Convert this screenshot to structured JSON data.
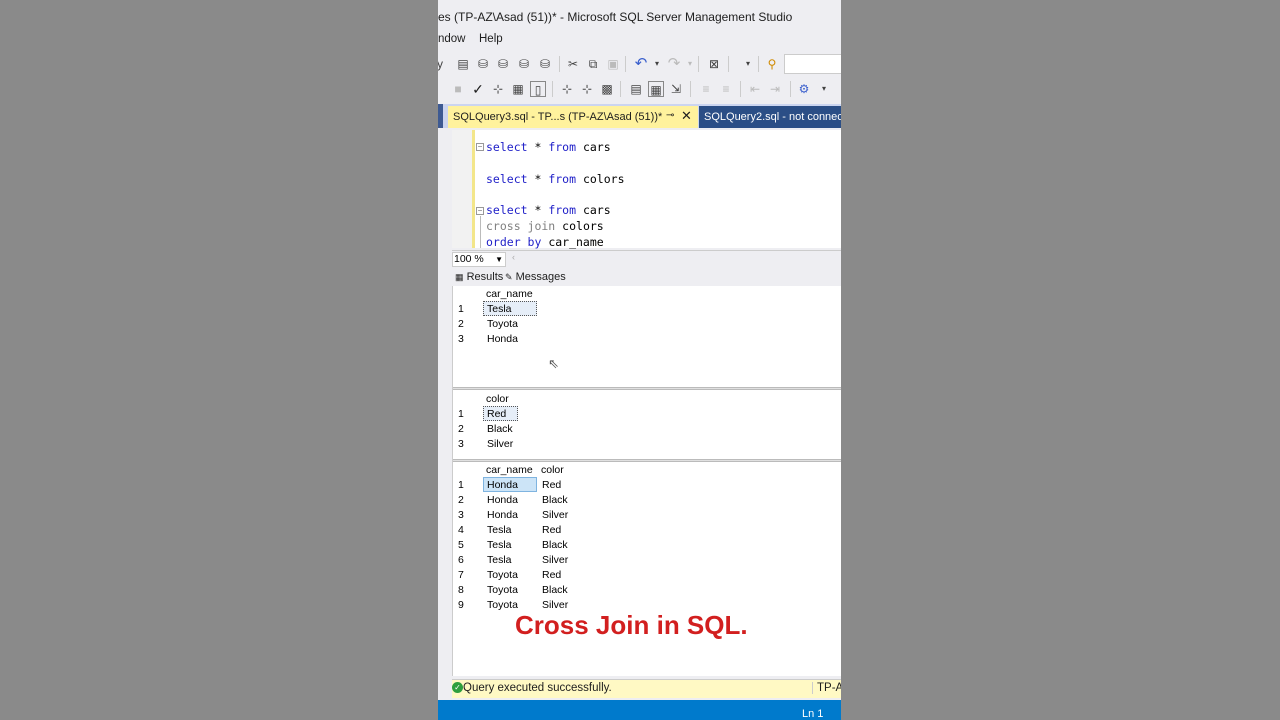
{
  "window": {
    "title": "es (TP-AZ\\Asad (51))* - Microsoft SQL Server Management Studio"
  },
  "menu": {
    "items": [
      "ndow",
      "Help"
    ]
  },
  "tabs": {
    "active": {
      "label": "SQLQuery3.sql - TP...s (TP-AZ\\Asad (51))*"
    },
    "other": {
      "label": "SQLQuery2.sql - not connected"
    }
  },
  "editor": {
    "lines": [
      {
        "kw1": "select",
        "rest1": " * ",
        "kw2": "from",
        "rest2": " cars"
      },
      {
        "kw1": "select",
        "rest1": " * ",
        "kw2": "from",
        "rest2": " colors"
      },
      {
        "kw1": "select",
        "rest1": " * ",
        "kw2": "from",
        "rest2": " cars"
      },
      {
        "kw1": "cross join",
        "rest1": " colors",
        "kw2": "",
        "rest2": ""
      },
      {
        "kw1": "order by",
        "rest1": " car_name",
        "kw2": "",
        "rest2": ""
      }
    ]
  },
  "zoom": {
    "value": "100 %"
  },
  "result_tabs": {
    "results": "Results",
    "messages": "Messages"
  },
  "grids": {
    "cars": {
      "header": "car_name",
      "rows": [
        {
          "num": "1",
          "car_name": "Tesla"
        },
        {
          "num": "2",
          "car_name": "Toyota"
        },
        {
          "num": "3",
          "car_name": "Honda"
        }
      ]
    },
    "colors": {
      "header": "color",
      "rows": [
        {
          "num": "1",
          "color": "Red"
        },
        {
          "num": "2",
          "color": "Black"
        },
        {
          "num": "3",
          "color": "Silver"
        }
      ]
    },
    "cross": {
      "headers": [
        "car_name",
        "color"
      ],
      "rows": [
        {
          "num": "1",
          "car_name": "Honda",
          "color": "Red"
        },
        {
          "num": "2",
          "car_name": "Honda",
          "color": "Black"
        },
        {
          "num": "3",
          "car_name": "Honda",
          "color": "Silver"
        },
        {
          "num": "4",
          "car_name": "Tesla",
          "color": "Red"
        },
        {
          "num": "5",
          "car_name": "Tesla",
          "color": "Black"
        },
        {
          "num": "6",
          "car_name": "Tesla",
          "color": "Silver"
        },
        {
          "num": "7",
          "car_name": "Toyota",
          "color": "Red"
        },
        {
          "num": "8",
          "car_name": "Toyota",
          "color": "Black"
        },
        {
          "num": "9",
          "car_name": "Toyota",
          "color": "Silver"
        }
      ]
    }
  },
  "overlay": {
    "caption": "Cross Join in SQL."
  },
  "status": {
    "message": "Query executed successfully.",
    "server": "TP-A"
  },
  "bottom": {
    "position": "Ln 1"
  },
  "colors": {
    "accent": "#007acc",
    "tab_active": "#fff29d",
    "caption": "#d21f1f"
  }
}
